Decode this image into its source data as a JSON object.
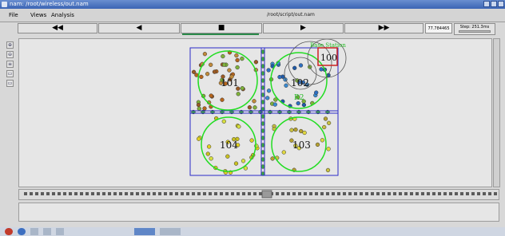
{
  "window": {
    "title": "nam: /root/wireless/out.nam",
    "filename": "/root/script/out.nam"
  },
  "menu": {
    "items": [
      "File",
      "Views",
      "Analysis"
    ]
  },
  "controls": {
    "rewind": "◀◀",
    "back": "◀",
    "stop": "■",
    "play": "▶",
    "fast_forward": "▶▶",
    "time": "77.784465",
    "step": "Step: 251.3ms"
  },
  "simulation": {
    "nodes": [
      {
        "id": "101",
        "label": "101"
      },
      {
        "id": "102",
        "label": "102"
      },
      {
        "id": "103",
        "label": "103"
      },
      {
        "id": "104",
        "label": "104"
      },
      {
        "id": "100",
        "label": "100"
      }
    ],
    "base_station_label": "Base  Station",
    "annotation_label": "R2"
  },
  "colors": {
    "cluster_boundary": "#2b2bc8",
    "range_circle": "#22dd22",
    "base_station_box": "#cc2222",
    "accent_progress": "#2a8a4a"
  }
}
